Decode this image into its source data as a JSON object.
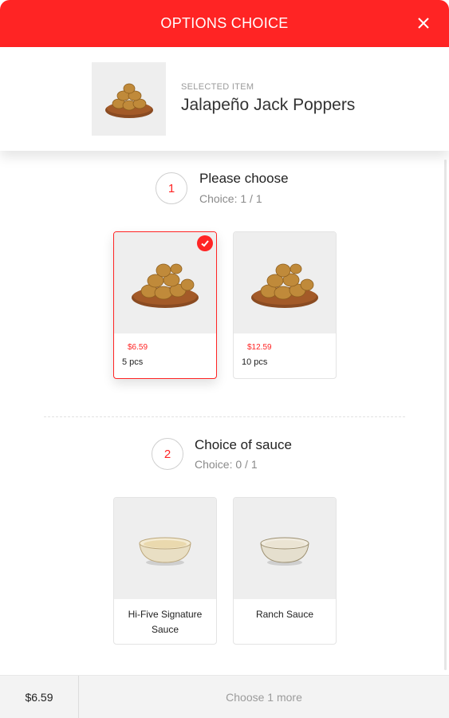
{
  "header": {
    "title": "OPTIONS CHOICE"
  },
  "selected": {
    "label": "SELECTED ITEM",
    "name": "Jalapeño Jack Poppers"
  },
  "steps": [
    {
      "number": "1",
      "title": "Please choose",
      "subtitle": "Choice: 1 / 1",
      "options": [
        {
          "price": "$6.59",
          "name": "5 pcs",
          "selected": true
        },
        {
          "price": "$12.59",
          "name": "10 pcs",
          "selected": false
        }
      ]
    },
    {
      "number": "2",
      "title": "Choice of sauce",
      "subtitle": "Choice: 0 / 1",
      "options": [
        {
          "name_line1": "Hi-Five Signature",
          "name_line2": "Sauce",
          "selected": false
        },
        {
          "name_line1": "Ranch Sauce",
          "name_line2": "",
          "selected": false
        }
      ]
    }
  ],
  "footer": {
    "total": "$6.59",
    "action": "Choose 1 more"
  },
  "colors": {
    "accent": "#ff2424",
    "muted": "#8a8a8a",
    "image_bg": "#eeeeee"
  }
}
